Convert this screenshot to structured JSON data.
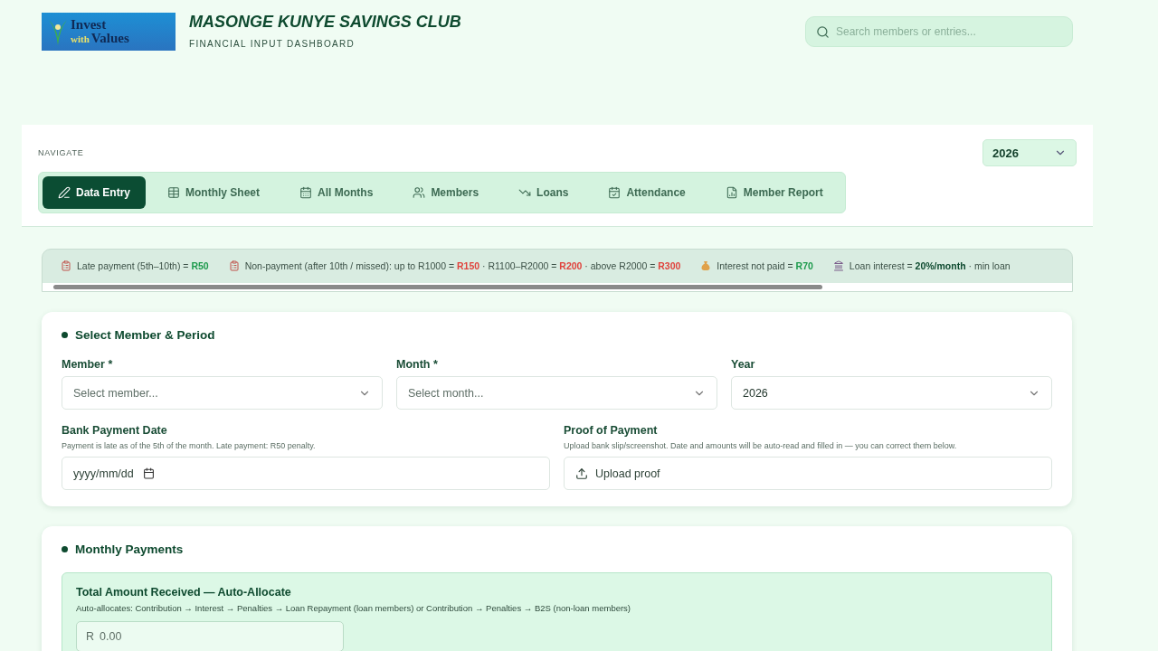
{
  "logo": {
    "words": [
      "Invest",
      "with",
      "Values"
    ]
  },
  "header": {
    "title": "MASONGE KUNYE SAVINGS CLUB",
    "subtitle": "FINANCIAL INPUT DASHBOARD"
  },
  "search": {
    "placeholder": "Search members or entries..."
  },
  "nav": {
    "label": "NAVIGATE",
    "year": "2026",
    "tabs": [
      {
        "label": "Data Entry",
        "selected": true
      },
      {
        "label": "Monthly Sheet",
        "selected": false
      },
      {
        "label": "All Months",
        "selected": false
      },
      {
        "label": "Members",
        "selected": false
      },
      {
        "label": "Loans",
        "selected": false
      },
      {
        "label": "Attendance",
        "selected": false
      },
      {
        "label": "Member Report",
        "selected": false
      }
    ]
  },
  "rules": [
    {
      "text": "Late payment (5th–10th) = **R50**"
    },
    {
      "text": "Non-payment (after 10th / missed): up to R1000 = **R150** · R1100–R2000 = **R200** · above R2000 = **R300**"
    },
    {
      "text": "Interest not paid = **R70**"
    },
    {
      "text": "Loan interest = **20%/month** · min loan"
    }
  ],
  "select_section": {
    "title": "Select Member & Period",
    "selects": [
      {
        "label": "Member *",
        "placeholder": "Select member..."
      },
      {
        "label": "Month *",
        "placeholder": "Select month..."
      },
      {
        "label": "Year",
        "value": "2026"
      }
    ],
    "bank_date": {
      "label": "Bank Payment Date",
      "hint": "Payment is late as of the 5th of the month. Late payment: R50 penalty.",
      "placeholder": "yyyy/mm/dd"
    },
    "proof": {
      "label": "Proof of Payment",
      "hint": "Upload bank slip/screenshot. Date and amounts will be auto-read and filled in — you can correct them below.",
      "button": "Upload proof"
    }
  },
  "payments_section": {
    "title": "Monthly Payments",
    "box_title": "Total Amount Received — Auto-Allocate",
    "box_hint": "Auto-allocates: Contribution → Interest → Penalties → Loan Repayment (loan members) or Contribution → Penalties → B2S (non-loan members)",
    "currency": "R",
    "placeholder": "0.00"
  }
}
